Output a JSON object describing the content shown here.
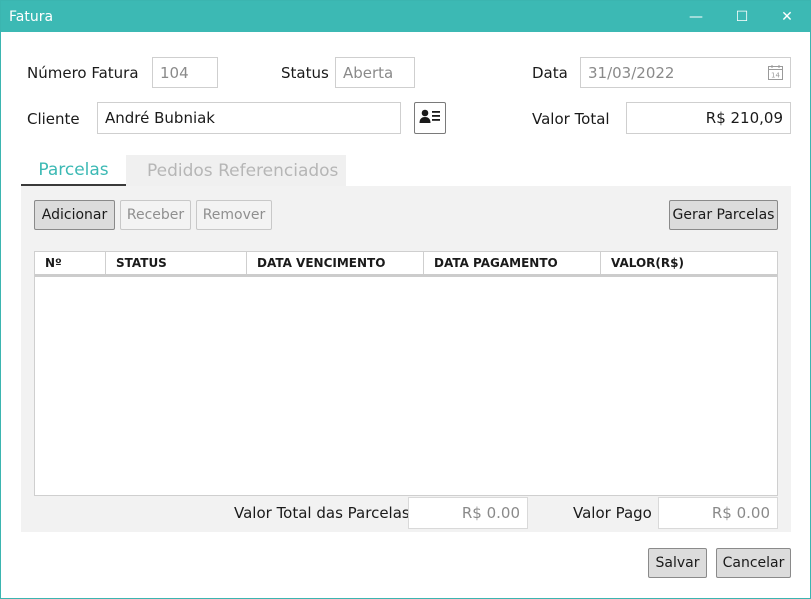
{
  "window": {
    "title": "Fatura",
    "minimize_glyph": "—",
    "maximize_glyph": "☐",
    "close_glyph": "✕"
  },
  "form": {
    "numero_label": "Número Fatura",
    "numero_value": "104",
    "status_label": "Status",
    "status_value": "Aberta",
    "data_label": "Data",
    "data_value": "31/03/2022",
    "data_icon": "calendar-icon",
    "cliente_label": "Cliente",
    "cliente_value": "André Bubniak",
    "cliente_icon": "contact-card-icon",
    "valor_total_label": "Valor Total",
    "valor_total_value": "R$ 210,09"
  },
  "tabs": [
    {
      "label": "Parcelas",
      "active": true
    },
    {
      "label": "Pedidos Referenciados",
      "active": false
    }
  ],
  "toolbar": {
    "adicionar": "Adicionar",
    "receber": "Receber",
    "remover": "Remover",
    "gerar_parcelas": "Gerar Parcelas"
  },
  "table": {
    "columns": [
      "Nº",
      "STATUS",
      "DATA VENCIMENTO",
      "DATA PAGAMENTO",
      "VALOR(R$)"
    ],
    "rows": []
  },
  "summary": {
    "valor_total_parcelas_label": "Valor Total das Parcelas",
    "valor_total_parcelas_value": "R$ 0.00",
    "valor_pago_label": "Valor Pago",
    "valor_pago_value": "R$ 0.00"
  },
  "actions": {
    "salvar": "Salvar",
    "cancelar": "Cancelar"
  },
  "colors": {
    "accent": "#3cb9b4",
    "panel": "#f2f2f2"
  }
}
